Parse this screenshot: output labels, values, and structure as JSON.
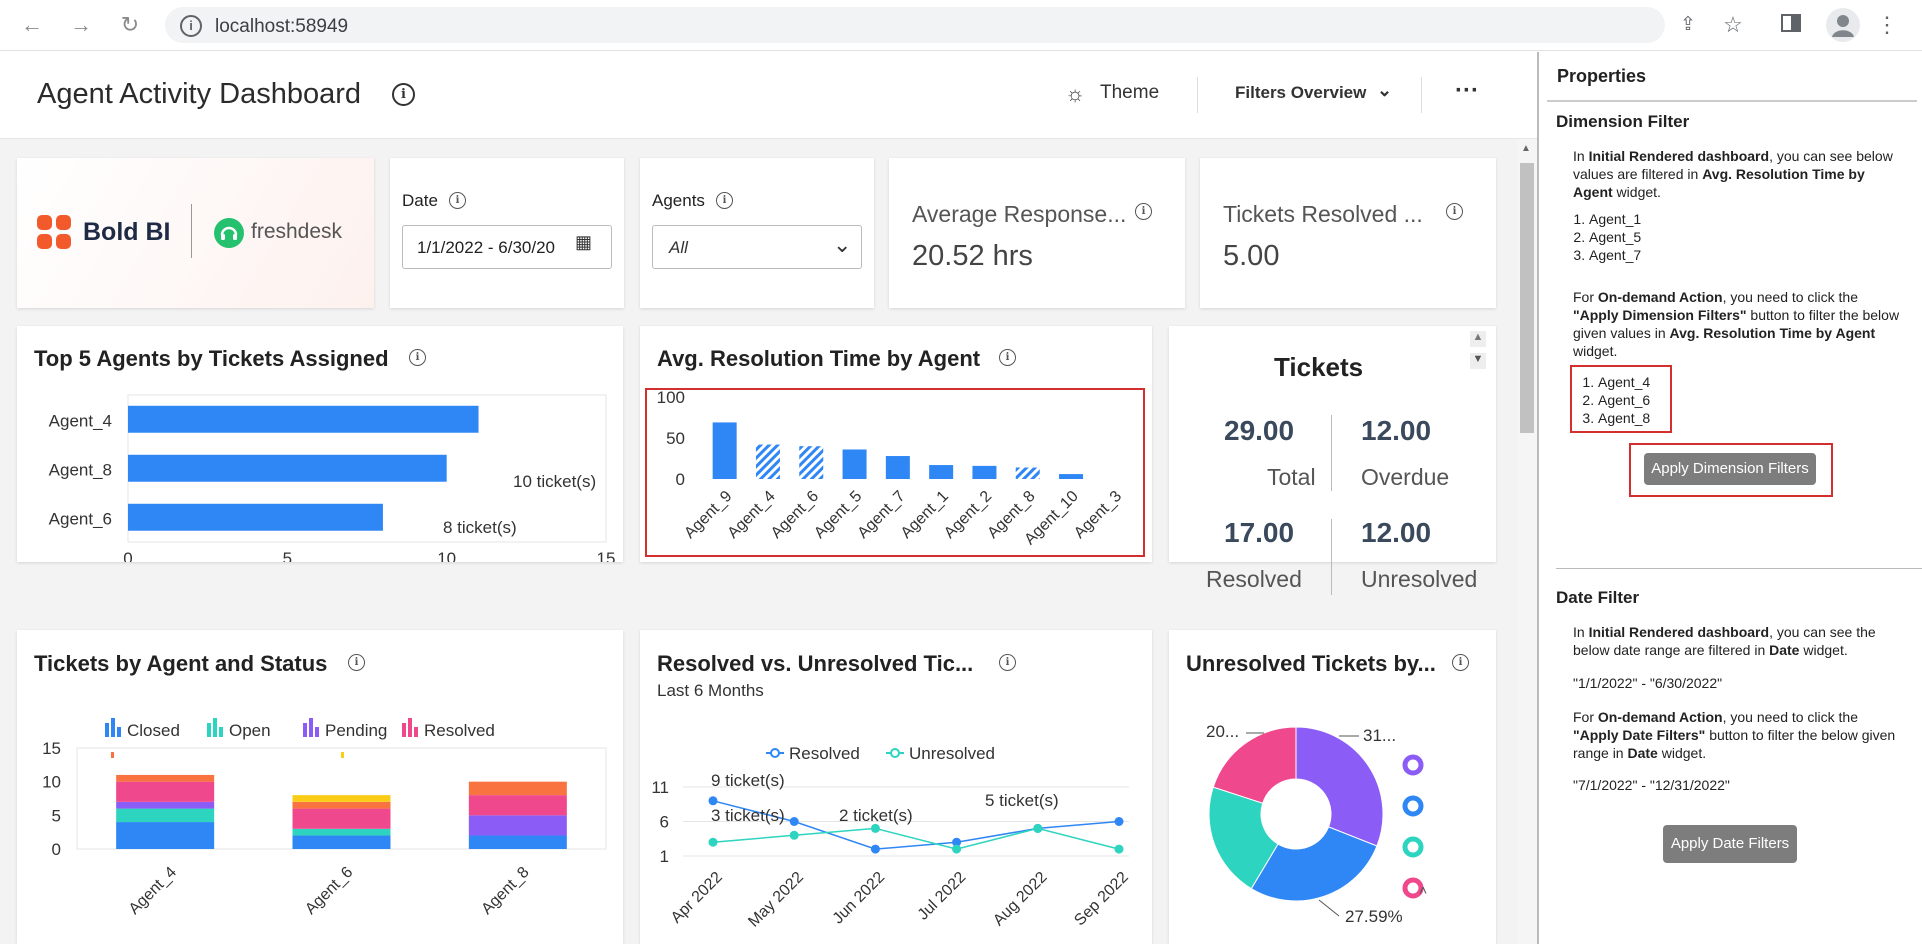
{
  "browser": {
    "url": "localhost:58949"
  },
  "header": {
    "title": "Agent Activity Dashboard",
    "theme_label": "Theme",
    "filters_label": "Filters Overview",
    "more_label": "···"
  },
  "logo": {
    "boldbi": "Bold BI",
    "freshdesk": "freshdesk"
  },
  "date_filter": {
    "label": "Date",
    "value": "1/1/2022 - 6/30/20"
  },
  "agents_filter": {
    "label": "Agents",
    "value": "All"
  },
  "kpis": [
    {
      "label": "Average Response...",
      "value": "20.52 hrs"
    },
    {
      "label": "Tickets Resolved ...",
      "value": "5.00"
    }
  ],
  "top5": {
    "title": "Top 5 Agents by Tickets Assigned",
    "labels": [
      "10 ticket(s)",
      "8 ticket(s)"
    ]
  },
  "avg_res": {
    "title": "Avg. Resolution Time by Agent"
  },
  "tickets": {
    "title": "Tickets",
    "cells": [
      {
        "value": "29.00",
        "label": "Total"
      },
      {
        "value": "12.00",
        "label": "Overdue"
      },
      {
        "value": "17.00",
        "label": "Resolved"
      },
      {
        "value": "12.00",
        "label": "Unresolved"
      }
    ]
  },
  "status_chart": {
    "title": "Tickets by Agent and Status",
    "legend": [
      "Closed",
      "Open",
      "Pending",
      "Resolved"
    ]
  },
  "resolved_chart": {
    "title": "Resolved vs. Unresolved Tic...",
    "subtitle": "Last 6 Months",
    "legend": [
      "Resolved",
      "Unresolved"
    ],
    "labels": [
      "9 ticket(s)",
      "3 ticket(s)",
      "2 ticket(s)",
      "5 ticket(s)"
    ]
  },
  "unresolved_chart": {
    "title": "Unresolved Tickets by...",
    "labels": [
      "20...",
      "31...",
      "27.59%"
    ]
  },
  "properties": {
    "title": "Properties",
    "dim_head": "Dimension Filter",
    "dim_intro_1": "In ",
    "dim_intro_b1": "Initial Rendered dashboard",
    "dim_intro_2": ", you can see below values are filtered in ",
    "dim_intro_b2": "Avg. Resolution Time by Agent",
    "dim_intro_3": " widget.",
    "dim_list1": [
      "Agent_1",
      "Agent_5",
      "Agent_7"
    ],
    "dim_ondemand_1": "For ",
    "dim_ondemand_b1": "On-demand Action",
    "dim_ondemand_2": ", you need to click the ",
    "dim_ondemand_b2": "\"Apply Dimension Filters\"",
    "dim_ondemand_3": " button to filter the below given values in ",
    "dim_ondemand_b3": "Avg. Resolution Time by Agent",
    "dim_ondemand_4": " widget.",
    "dim_list2": [
      "Agent_4",
      "Agent_6",
      "Agent_8"
    ],
    "dim_button": "Apply Dimension Filters",
    "date_head": "Date Filter",
    "date_intro_1": "In ",
    "date_intro_b1": "Initial Rendered dashboard",
    "date_intro_2": ", you can see the below date range are filtered in ",
    "date_intro_b2": "Date",
    "date_intro_3": " widget.",
    "date_range1": "\"1/1/2022\" - \"6/30/2022\"",
    "date_ondemand_1": "For ",
    "date_ondemand_b1": "On-demand Action",
    "date_ondemand_2": ", you need to click the ",
    "date_ondemand_b2": "\"Apply Date Filters\"",
    "date_ondemand_3": " button to filter the below given range in ",
    "date_ondemand_b3": "Date",
    "date_ondemand_4": " widget.",
    "date_range2": "\"7/1/2022\" - \"12/31/2022\"",
    "date_button": "Apply Date Filters"
  },
  "chart_data": [
    {
      "type": "bar",
      "title": "Top 5 Agents by Tickets Assigned",
      "orientation": "horizontal",
      "categories": [
        "Agent_4",
        "Agent_8",
        "Agent_6"
      ],
      "values": [
        11,
        10,
        8
      ],
      "xlim": [
        0,
        15
      ],
      "xticks": [
        "0",
        "5",
        "10",
        "15"
      ]
    },
    {
      "type": "bar",
      "title": "Avg. Resolution Time by Agent",
      "categories": [
        "Agent_9",
        "Agent_4",
        "Agent_6",
        "Agent_5",
        "Agent_7",
        "Agent_1",
        "Agent_2",
        "Agent_8",
        "Agent_10",
        "Agent_3"
      ],
      "values": [
        69,
        42,
        40,
        36,
        28,
        17,
        16,
        14,
        6,
        0
      ],
      "hatched": [
        "Agent_4",
        "Agent_6",
        "Agent_8"
      ],
      "ylim": [
        0,
        100
      ],
      "yticks": [
        "0",
        "50",
        "100"
      ]
    },
    {
      "type": "bar",
      "title": "Tickets by Agent and Status",
      "stacked": true,
      "categories": [
        "Agent_4",
        "Agent_6",
        "Agent_8"
      ],
      "series": [
        {
          "name": "Closed",
          "color": "#2f86f5",
          "values": [
            4,
            2,
            2
          ]
        },
        {
          "name": "Open",
          "color": "#2dd4bf",
          "values": [
            2,
            1,
            0
          ]
        },
        {
          "name": "Pending",
          "color": "#8b5cf6",
          "values": [
            1,
            0,
            3
          ]
        },
        {
          "name": "Resolved",
          "color": "#f0488c",
          "values": [
            3,
            3,
            3
          ]
        },
        {
          "color": "#f97341",
          "values": [
            1,
            1,
            2
          ]
        },
        {
          "color": "#facc15",
          "values": [
            0,
            1,
            0
          ]
        }
      ],
      "ylim": [
        0,
        15
      ],
      "yticks": [
        "0",
        "5",
        "10",
        "15"
      ]
    },
    {
      "type": "line",
      "title": "Resolved vs. Unresolved Tic...",
      "x": [
        "Apr 2022",
        "May 2022",
        "Jun 2022",
        "Jul 2022",
        "Aug 2022",
        "Sep 2022"
      ],
      "series": [
        {
          "name": "Resolved",
          "color": "#2f86f5",
          "values": [
            9,
            6,
            2,
            3,
            5,
            6
          ]
        },
        {
          "name": "Unresolved",
          "color": "#2dd4bf",
          "values": [
            3,
            4,
            5,
            2,
            5,
            2
          ]
        }
      ],
      "ylim": [
        1,
        11
      ],
      "yticks": [
        "1",
        "6",
        "11"
      ]
    },
    {
      "type": "pie",
      "title": "Unresolved Tickets by...",
      "donut": true,
      "slices": [
        {
          "value": 31,
          "color": "#8b5cf6"
        },
        {
          "value": 27.59,
          "color": "#2f86f5"
        },
        {
          "value": 21.41,
          "color": "#2dd4bf"
        },
        {
          "value": 20,
          "color": "#f0488c"
        }
      ]
    }
  ]
}
